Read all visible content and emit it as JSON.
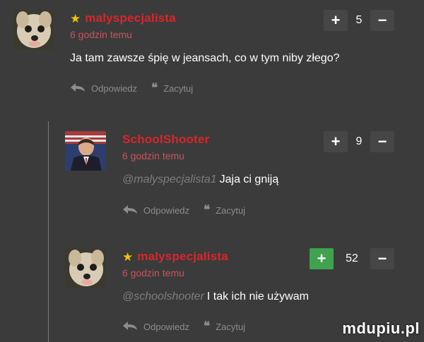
{
  "comments": [
    {
      "username": "malyspecjalista",
      "starred": true,
      "time": "6 godzin temu",
      "mention": "",
      "text": "Ja tam zawsze śpię w jeansach, co w tym niby złego?",
      "votes": "5",
      "reply_label": "Odpowiedz",
      "quote_label": "Zacytuj"
    },
    {
      "username": "SchoolShooter",
      "starred": false,
      "time": "6 godzin temu",
      "mention": "@malyspecjalista1",
      "text": "Jaja ci gniją",
      "votes": "9",
      "reply_label": "Odpowiedz",
      "quote_label": "Zacytuj"
    },
    {
      "username": "malyspecjalista",
      "starred": true,
      "time": "6 godzin temu",
      "mention": "@schoolshooter",
      "text": "I tak ich nie używam",
      "votes": "52",
      "reply_label": "Odpowiedz",
      "quote_label": "Zacytuj"
    }
  ],
  "icons": {
    "star": "star-icon",
    "reply": "reply-arrow-icon",
    "quote": "quote-icon",
    "plus": "plus-icon",
    "minus": "minus-icon"
  },
  "colors": {
    "background": "#3b3b3b",
    "username": "#d8262b",
    "time": "#c9535b",
    "star": "#f2c200",
    "upvote_active": "#3fa34d",
    "button": "#464646"
  },
  "watermark": "mdupiu.pl"
}
